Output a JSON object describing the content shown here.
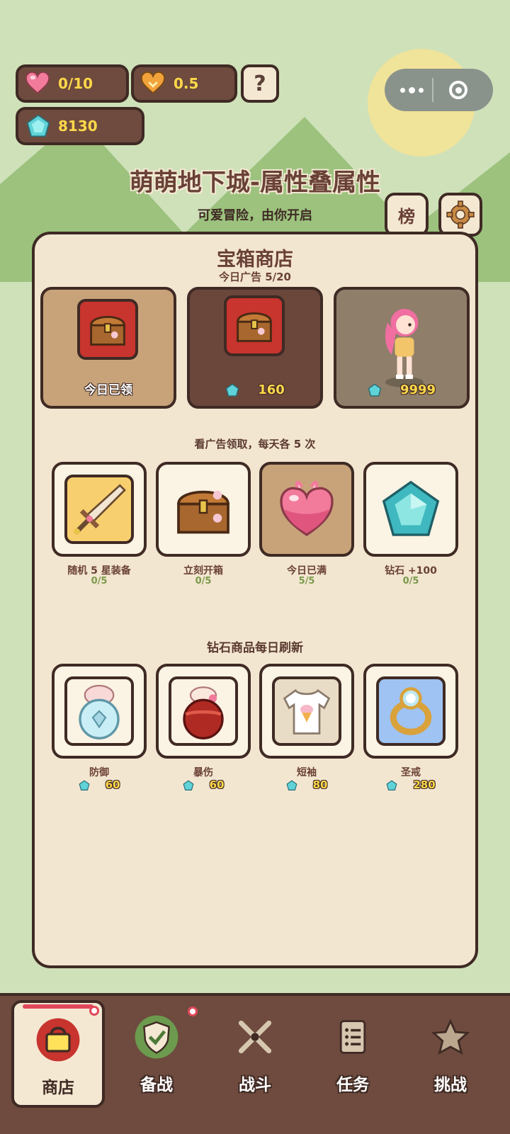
{
  "resources": {
    "stamina": "0/10",
    "multiplier": "0.5",
    "diamonds": "8130",
    "help_label": "?"
  },
  "header": {
    "title": "萌萌地下城-属性叠属性",
    "subtitle": "可爱冒险，由你开启",
    "rank_label": "榜"
  },
  "shop": {
    "title": "宝箱商店",
    "ad_count": "今日广告 5/20",
    "chest_cards": [
      {
        "label": "今日已领"
      },
      {
        "price": "160"
      },
      {
        "price": "9999"
      }
    ],
    "ad_section_title": "看广告领取，每天各 5 次",
    "ad_items": [
      {
        "name": "随机 5 星装备",
        "count": "0/5",
        "icon": "sword-icon"
      },
      {
        "name": "立刻开箱",
        "count": "0/5",
        "icon": "treasure-chest-icon"
      },
      {
        "name": "今日已满",
        "count": "5/5",
        "icon": "heart-potion-icon"
      },
      {
        "name": "钻石 +100",
        "count": "0/5",
        "icon": "diamond-icon"
      }
    ],
    "diamond_section_title": "钻石商品每日刷新",
    "diamond_items": [
      {
        "name": "防御",
        "price": "60",
        "icon": "defense-potion-icon"
      },
      {
        "name": "暴伤",
        "price": "60",
        "icon": "crit-potion-icon"
      },
      {
        "name": "短袖",
        "price": "80",
        "icon": "tshirt-icon"
      },
      {
        "name": "圣戒",
        "price": "280",
        "icon": "ring-icon"
      }
    ]
  },
  "nav": [
    {
      "label": "商店",
      "icon": "shop-bag-icon",
      "active": true
    },
    {
      "label": "备战",
      "icon": "shield-check-icon"
    },
    {
      "label": "战斗",
      "icon": "crossed-swords-icon"
    },
    {
      "label": "任务",
      "icon": "task-list-icon"
    },
    {
      "label": "挑战",
      "icon": "star-icon"
    }
  ],
  "colors": {
    "background": "#cfe1b9",
    "panel": "#f3e6d1",
    "border": "#3f2a24",
    "brown": "#6e4b3e",
    "gold_text": "#ffd84a",
    "active_card": "#c8a37a",
    "dark_card": "#6b463b",
    "gray_card": "#8f7e6a"
  }
}
